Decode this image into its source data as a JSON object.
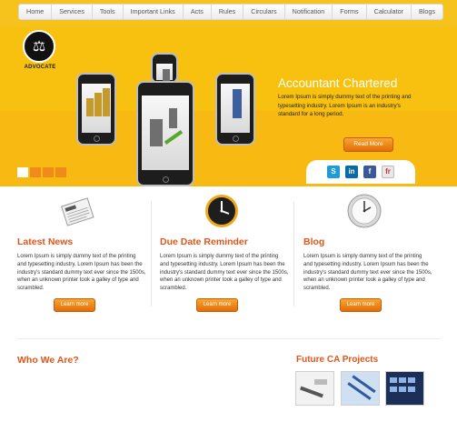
{
  "nav": {
    "items": [
      "Home",
      "Services",
      "Tools",
      "Important Links",
      "Acts",
      "Rules",
      "Circulars",
      "Notification",
      "Forms",
      "Calculator",
      "Blogs"
    ]
  },
  "brand": {
    "logo_text": "ADVOCATE"
  },
  "hero": {
    "title": "Accountant Chartered",
    "text": "Lorem Ipsum is simply dummy text of the printing and typesetting industry. Lorem Ipsum is an industry's standard for a long period.",
    "button": "Read More",
    "slider_dots": 4,
    "active_dot": 0
  },
  "social": {
    "icons": [
      "skype-icon",
      "linkedin-icon",
      "facebook-icon",
      "friendfeed-icon"
    ],
    "labels": [
      "S",
      "in",
      "f",
      "fr"
    ]
  },
  "columns": [
    {
      "title": "Latest News",
      "icon": "newspaper-icon",
      "text": "Lorem Ipsum is simply dummy text of the printing and typesetting industry. Lorem Ipsum has been the industry's standard dummy text ever since the 1500s, when an unknown printer took a galley of type and scrambled.",
      "button": "Learn more"
    },
    {
      "title": "Due Date Reminder",
      "icon": "clock-icon",
      "text": "Lorem Ipsum is simply dummy text of the printing and typesetting industry. Lorem Ipsum has been the industry's standard dummy text ever since the 1500s, when an unknown printer took a galley of type and scrambled.",
      "button": "Learn more"
    },
    {
      "title": "Blog",
      "icon": "wall-clock-icon",
      "text": "Lorem Ipsum is simply dummy text of the printing and typesetting industry. Lorem Ipsum has been the industry's standard dummy text ever since the 1500s, when an unknown printer took a galley of type and scrambled.",
      "button": "Learn more"
    }
  ],
  "bottom": {
    "who_title": "Who We Are?",
    "future_title": "Future CA Projects"
  },
  "colors": {
    "brand_yellow": "#f9c10f",
    "accent_orange": "#e0561a",
    "button_orange": "#ef8a1d"
  }
}
